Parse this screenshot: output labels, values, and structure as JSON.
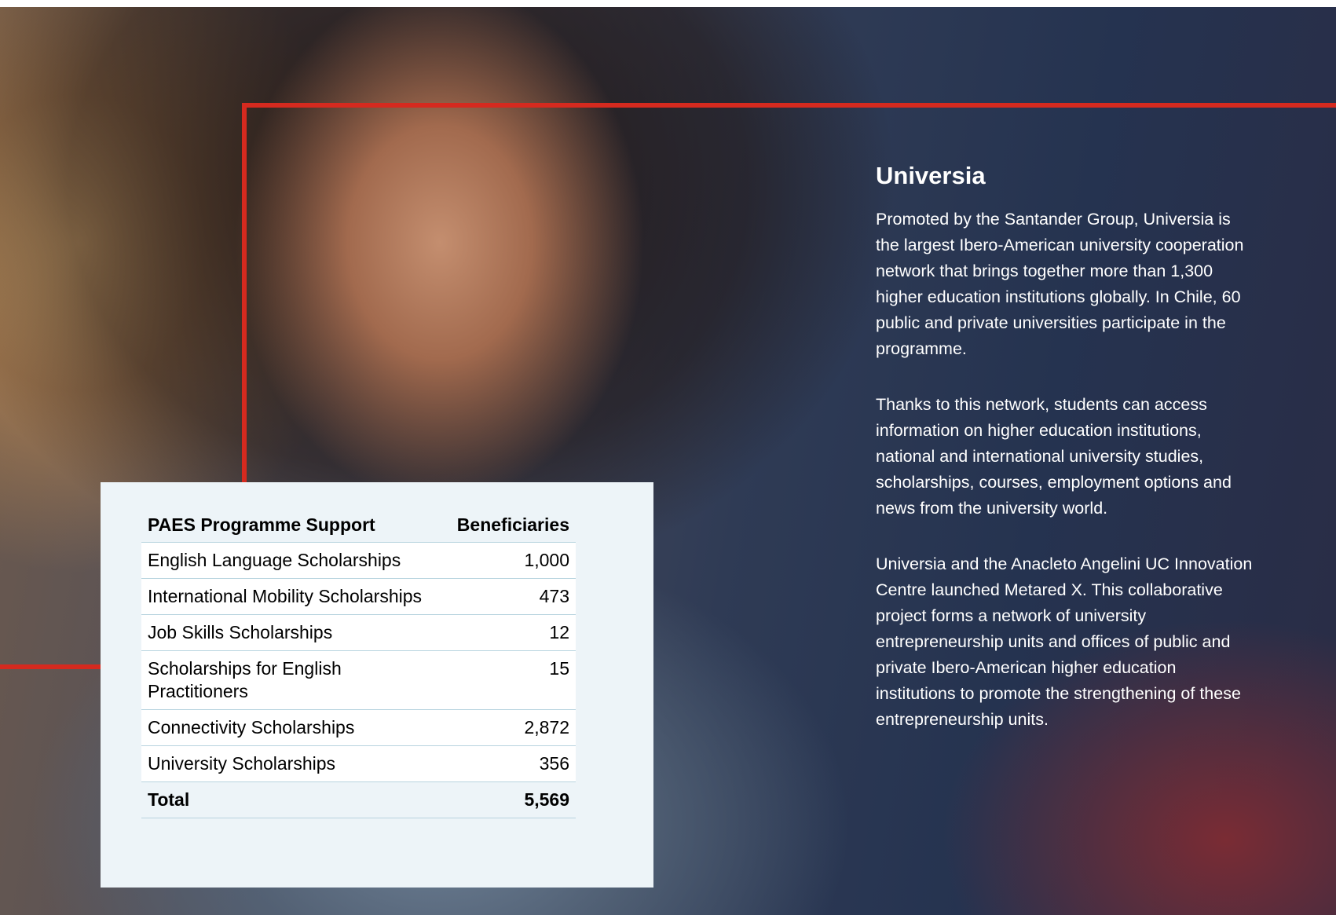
{
  "table": {
    "headers": [
      "PAES Programme Support",
      "Beneficiaries"
    ],
    "rows": [
      {
        "label": "English Language Scholarships",
        "value": "1,000"
      },
      {
        "label": "International Mobility Scholarships",
        "value": "473"
      },
      {
        "label": "Job Skills Scholarships",
        "value": "12"
      },
      {
        "label": "Scholarships for English Practitioners",
        "value": "15"
      },
      {
        "label": "Connectivity Scholarships",
        "value": "2,872"
      },
      {
        "label": "University Scholarships",
        "value": "356"
      }
    ],
    "total": {
      "label": "Total",
      "value": "5,569"
    }
  },
  "article": {
    "title": "Universia",
    "paragraphs": [
      "Promoted by the Santander Group, Universia is the largest Ibero-American university cooperation network that brings together more than 1,300 higher education institutions globally. In Chile, 60 public and private universities participate in the programme.",
      "Thanks to this network, students can access information on higher education institutions, national and international university studies, scholarships, courses, employment options and news from the university world.",
      " Universia and the Anacleto Angelini UC Innovation Centre launched Metared X. This collaborative project forms a network of university entrepreneurship units and offices of public and private Ibero-American higher education institutions to promote the strengthening of these entrepreneurship units."
    ]
  },
  "colors": {
    "accent_red": "#d52a1f",
    "table_background": "#edf4f8",
    "table_rule": "#b8d4df",
    "text_on_photo": "#ffffff"
  }
}
